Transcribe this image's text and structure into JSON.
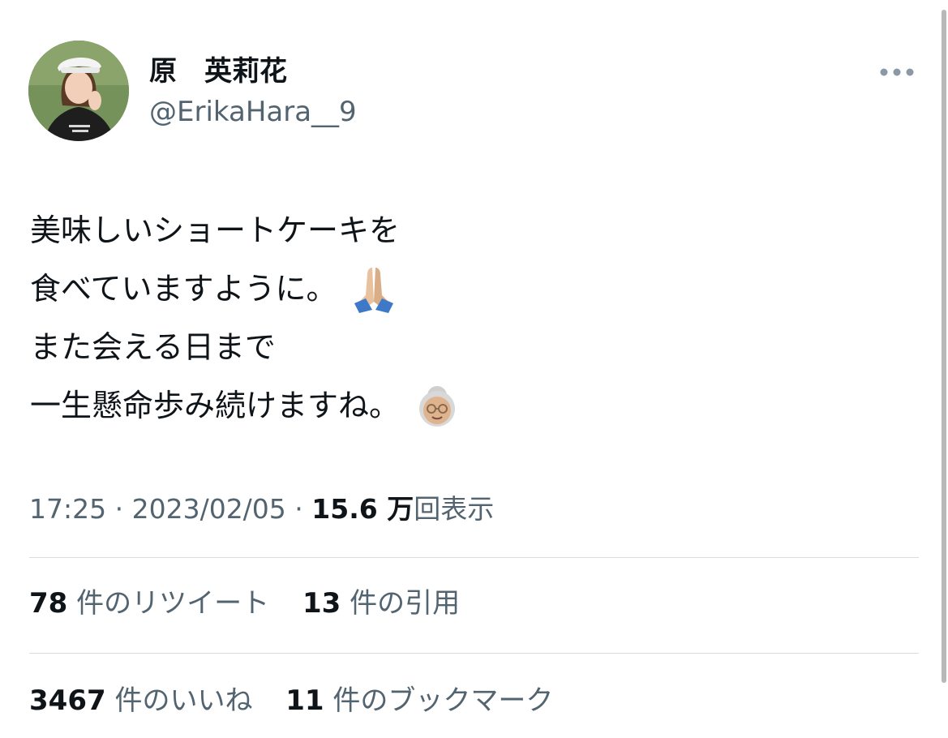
{
  "author": {
    "display_name": "原　英莉花",
    "handle": "@ErikaHara__9"
  },
  "tweet": {
    "lines": [
      "美味しいショートケーキを",
      "食べていますように。",
      "また会える日まで",
      "一生懸命歩み続けますね。"
    ],
    "emojis": [
      "folded-hands-icon",
      "old-woman-icon"
    ]
  },
  "meta": {
    "time": "17:25",
    "separator": " · ",
    "date": "2023/02/05",
    "views_count": "15.6 万",
    "views_label": "回表示"
  },
  "stats": {
    "retweets_count": "78",
    "retweets_label": "件のリツイート",
    "quotes_count": "13",
    "quotes_label": "件の引用",
    "likes_count": "3467",
    "likes_label": "件のいいね",
    "bookmarks_count": "11",
    "bookmarks_label": "件のブックマーク"
  },
  "colors": {
    "text_primary": "#0f1419",
    "text_secondary": "#536471",
    "divider": "#d9dde0"
  }
}
